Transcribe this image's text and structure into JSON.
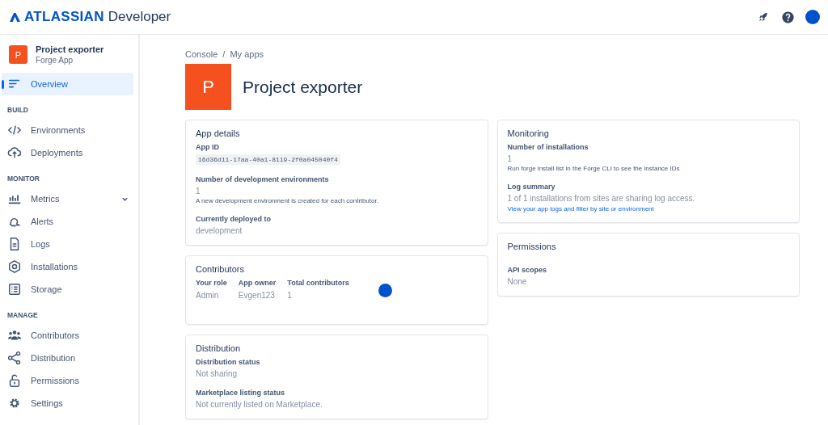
{
  "header": {
    "brand": "ATLASSIAN",
    "product": "Developer"
  },
  "sidebar": {
    "app": {
      "initial": "P",
      "name": "Project exporter",
      "type": "Forge App"
    },
    "sections": [
      {
        "items": [
          {
            "label": "Overview",
            "kind": "link",
            "selected": true
          }
        ]
      },
      {
        "heading": "BUILD",
        "items": [
          {
            "label": "Environments",
            "kind": "link",
            "selected": false
          },
          {
            "label": "Deployments",
            "kind": "link",
            "selected": false
          }
        ]
      },
      {
        "heading": "MONITOR",
        "items": [
          {
            "label": "Metrics",
            "kind": "group",
            "selected": false
          },
          {
            "label": "Alerts",
            "kind": "link",
            "selected": false
          },
          {
            "label": "Logs",
            "kind": "link",
            "selected": false
          },
          {
            "label": "Installations",
            "kind": "link",
            "selected": false
          },
          {
            "label": "Storage",
            "kind": "link",
            "selected": false
          }
        ]
      },
      {
        "heading": "MANAGE",
        "items": [
          {
            "label": "Contributors",
            "kind": "link",
            "selected": false
          },
          {
            "label": "Distribution",
            "kind": "link",
            "selected": false
          },
          {
            "label": "Permissions",
            "kind": "link",
            "selected": false
          },
          {
            "label": "Settings",
            "kind": "link",
            "selected": false
          }
        ]
      }
    ]
  },
  "breadcrumb": {
    "items": [
      "Console",
      "My apps"
    ],
    "separator": "/"
  },
  "app_header": {
    "initial": "P",
    "title": "Project exporter"
  },
  "columns": [
    [
      {
        "title": "App details",
        "groups": [
          [
            {
              "kind": "label",
              "text": "App ID"
            },
            {
              "kind": "code",
              "text": "16d36d11-17aa-40a1-8119-2f0a045040f4"
            }
          ],
          [
            {
              "kind": "label",
              "text": "Number of development environments"
            },
            {
              "kind": "value",
              "text": "1"
            },
            {
              "kind": "note",
              "text": "A new development environment is created for each contributor."
            }
          ],
          [
            {
              "kind": "label",
              "text": "Currently deployed to"
            },
            {
              "kind": "value",
              "text": "development"
            }
          ]
        ]
      },
      {
        "title": "Contributors",
        "table": [
          {
            "label": "Your role",
            "value": "Admin"
          },
          {
            "label": "App owner",
            "value": "Evgen123"
          },
          {
            "label": "Total contributors",
            "value": "1"
          }
        ]
      },
      {
        "title": "Distribution",
        "groups": [
          [
            {
              "kind": "label",
              "text": "Distribution status"
            },
            {
              "kind": "value",
              "text": "Not sharing"
            }
          ],
          [
            {
              "kind": "label",
              "text": "Marketplace listing status"
            },
            {
              "kind": "value",
              "text": "Not currently listed on Marketplace."
            }
          ]
        ]
      }
    ],
    [
      {
        "title": "Monitoring",
        "groups": [
          [
            {
              "kind": "label",
              "text": "Number of installations"
            },
            {
              "kind": "value",
              "text": "1"
            },
            {
              "kind": "note",
              "text": "Run forge install list in the Forge CLI to see the instance IDs"
            }
          ],
          [
            {
              "kind": "label",
              "text": "Log summary"
            },
            {
              "kind": "value",
              "text": "1 of 1 installations from sites are sharing log access."
            },
            {
              "kind": "link",
              "text": "View your app logs and filter by site or environment"
            }
          ]
        ]
      },
      {
        "title": "Permissions",
        "groups": [
          [
            {
              "kind": "label",
              "text": "API scopes"
            },
            {
              "kind": "value",
              "text": "None"
            }
          ]
        ]
      }
    ]
  ]
}
